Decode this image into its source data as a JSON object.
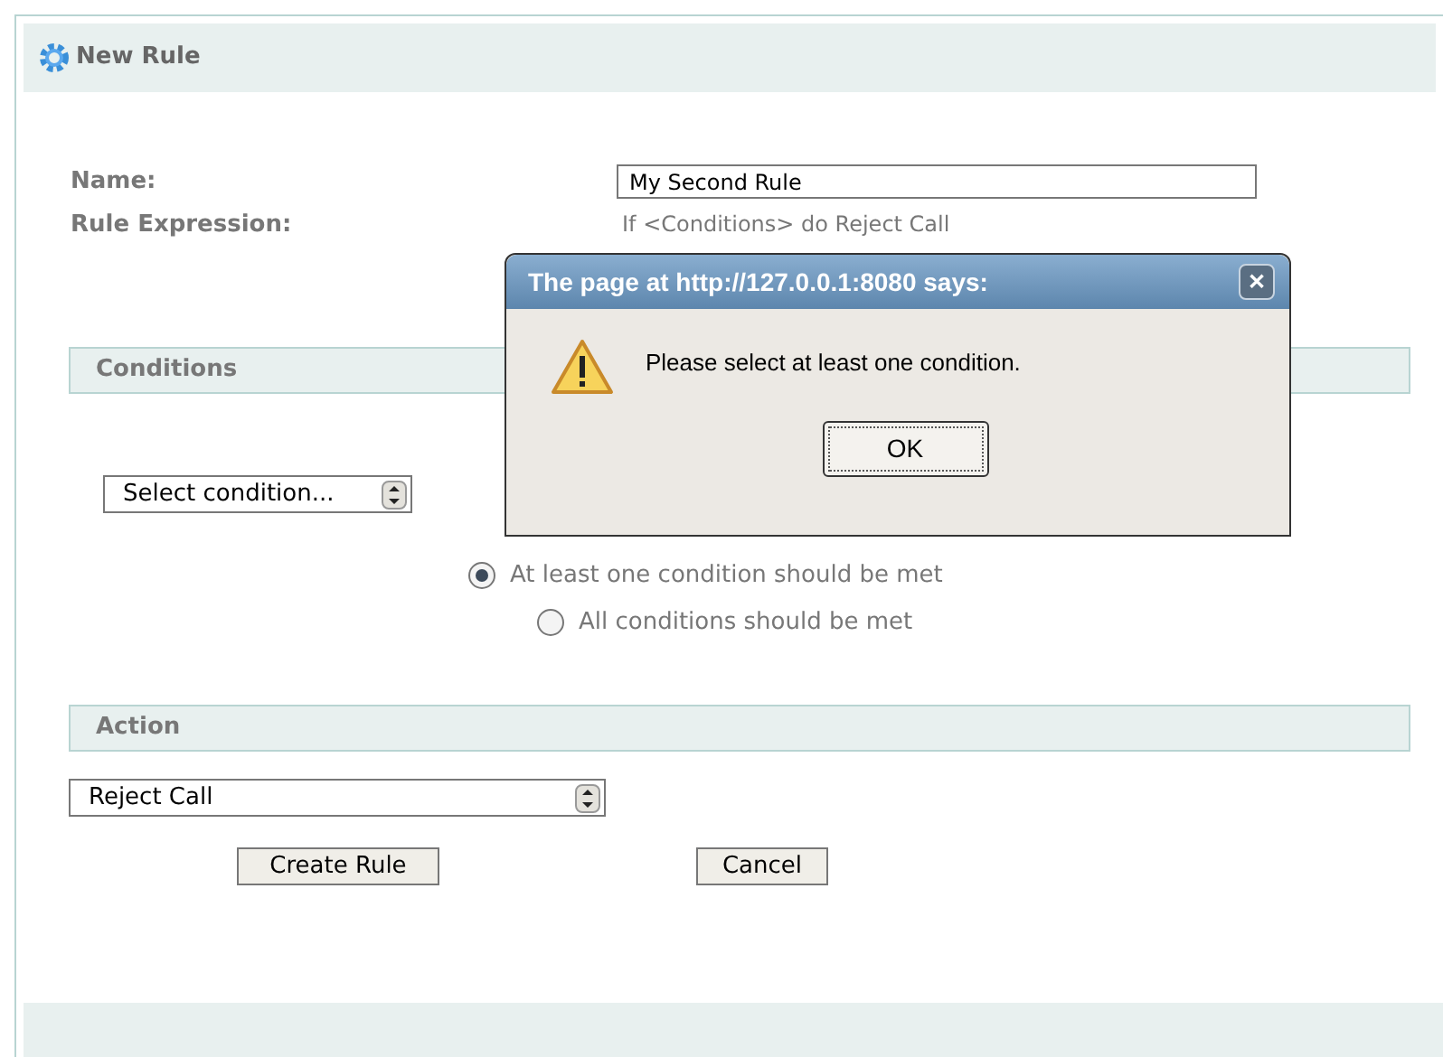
{
  "panel": {
    "title": "New Rule"
  },
  "form": {
    "name_label": "Name:",
    "name_value": "My Second Rule",
    "expression_label": "Rule Expression:",
    "expression_value": "If <Conditions> do Reject Call"
  },
  "conditions": {
    "title": "Conditions",
    "select_value": "Select condition...",
    "match_options": [
      {
        "label": "At least one condition should be met",
        "selected": true
      },
      {
        "label": "All conditions should be met",
        "selected": false
      }
    ]
  },
  "action": {
    "title": "Action",
    "select_value": "Reject Call"
  },
  "buttons": [
    "Create Rule",
    "Cancel"
  ],
  "dialog": {
    "title": "The page at http://127.0.0.1:8080 says:",
    "close": "✕",
    "message": "Please select at least one condition.",
    "button": "OK"
  }
}
